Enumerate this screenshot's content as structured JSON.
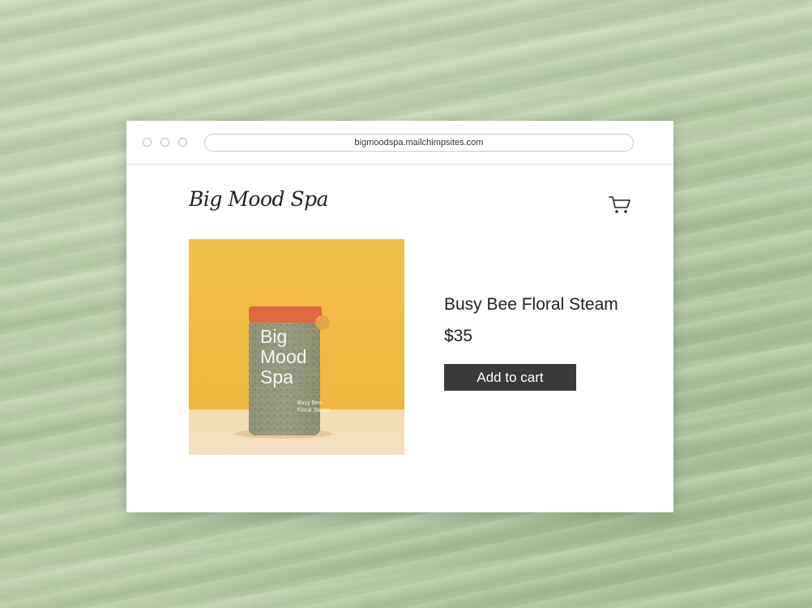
{
  "browser": {
    "url": "bigmoodspa.mailchimpsites.com"
  },
  "site": {
    "logo_text": "Big Mood Spa",
    "cart_icon": "cart-icon"
  },
  "product": {
    "name": "Busy Bee Floral Steam",
    "price": "$35",
    "add_to_cart_label": "Add to cart",
    "jar_label_lines": [
      "Big",
      "Mood",
      "Spa"
    ],
    "jar_sublabel_lines": [
      "Busy Bee",
      "Floral Steam"
    ]
  },
  "colors": {
    "background": "#b9cda8",
    "button": "#3c3a38",
    "image_backdrop": "#f0bd45",
    "jar_lid": "#e0673f"
  }
}
